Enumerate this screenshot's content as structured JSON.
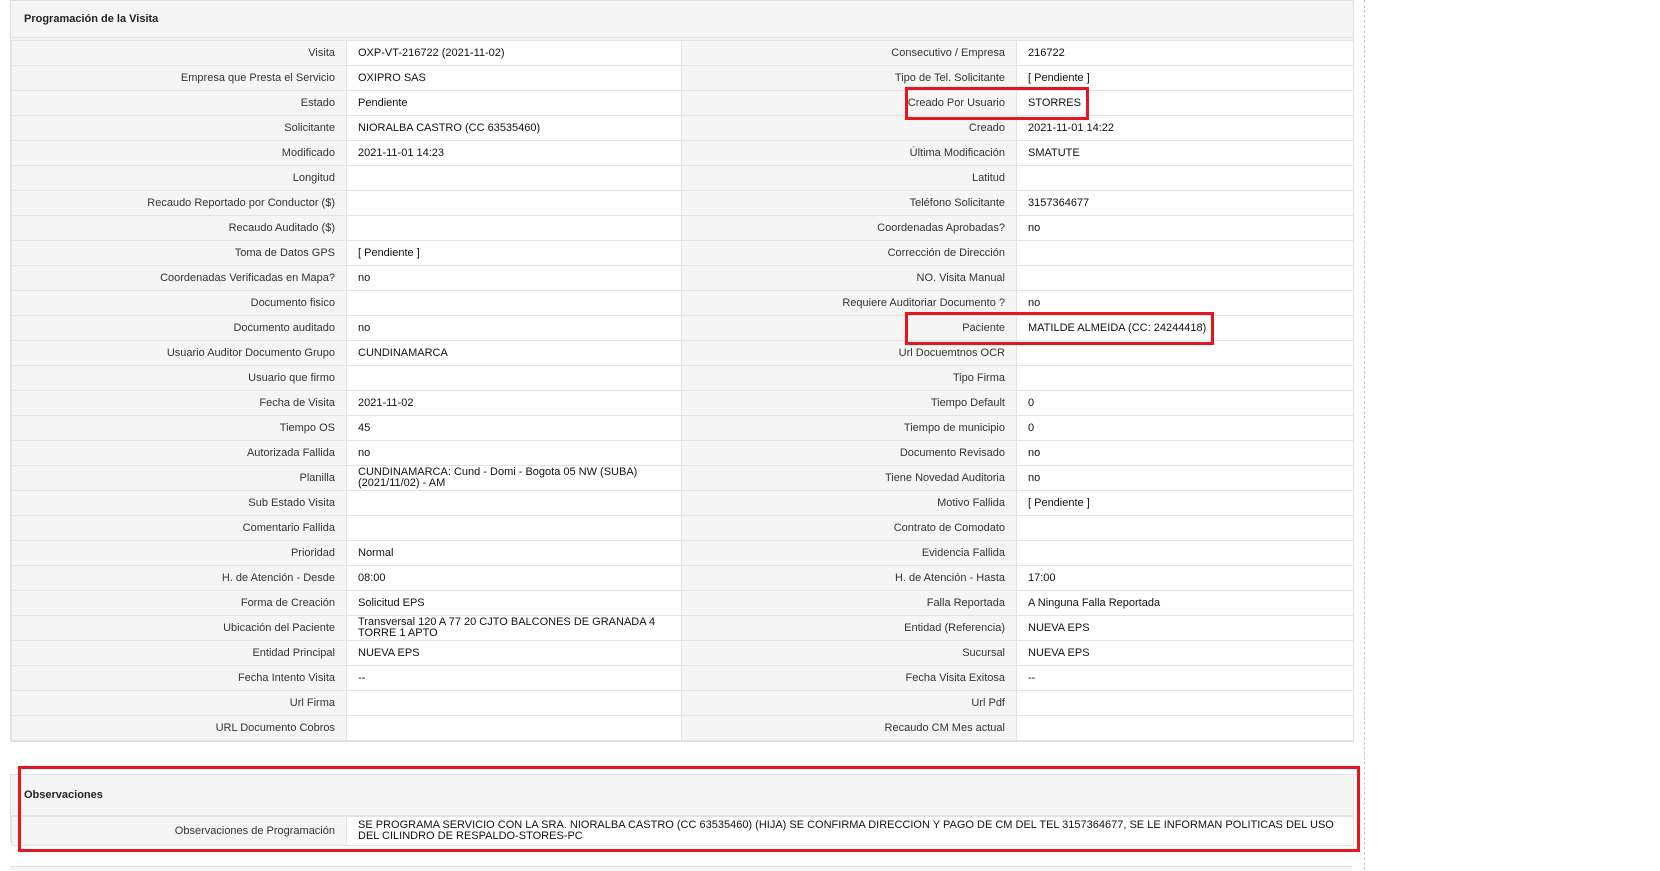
{
  "visit_section": {
    "title": "Programación de la Visita",
    "rows": [
      {
        "l1": "Visita",
        "v1": "OXP-VT-216722 (2021-11-02)",
        "l2": "Consecutivo / Empresa",
        "v2": "216722"
      },
      {
        "l1": "Empresa que Presta el Servicio",
        "v1": "OXIPRO SAS",
        "l2": "Tipo de Tel. Solicitante",
        "v2": "[ Pendiente ]"
      },
      {
        "l1": "Estado",
        "v1": "Pendiente",
        "l2": "Creado Por Usuario",
        "v2": "STORRES"
      },
      {
        "l1": "Solicitante",
        "v1": "NIORALBA CASTRO (CC 63535460)",
        "l2": "Creado",
        "v2": "2021-11-01 14:22"
      },
      {
        "l1": "Modificado",
        "v1": "2021-11-01 14:23",
        "l2": "Última Modificación",
        "v2": " SMATUTE"
      },
      {
        "l1": "Longitud",
        "v1": "",
        "l2": "Latitud",
        "v2": ""
      },
      {
        "l1": "Recaudo Reportado por Conductor ($)",
        "v1": "",
        "l2": "Teléfono Solicitante",
        "v2": "3157364677"
      },
      {
        "l1": "Recaudo Auditado ($)",
        "v1": "",
        "l2": "Coordenadas Aprobadas?",
        "v2": " no"
      },
      {
        "l1": "Toma de Datos GPS",
        "v1": "[ Pendiente ]",
        "l2": "Corrección de Dirección",
        "v2": ""
      },
      {
        "l1": "Coordenadas Verificadas en Mapa?",
        "v1": " no",
        "l2": "NO. Visita Manual",
        "v2": ""
      },
      {
        "l1": "Documento fisico",
        "v1": "",
        "l2": "Requiere Auditoriar Documento ?",
        "v2": " no"
      },
      {
        "l1": "Documento auditado",
        "v1": " no",
        "l2": "Paciente",
        "v2": "MATILDE ALMEIDA (CC: 24244418)"
      },
      {
        "l1": "Usuario Auditor Documento Grupo",
        "v1": "CUNDINAMARCA",
        "l2": "Url Docuemtnos OCR",
        "v2": ""
      },
      {
        "l1": "Usuario que firmo",
        "v1": "",
        "l2": "Tipo Firma",
        "v2": ""
      },
      {
        "l1": "Fecha de Visita",
        "v1": " 2021-11-02",
        "l2": "Tiempo Default",
        "v2": "0"
      },
      {
        "l1": "Tiempo OS",
        "v1": "45",
        "l2": "Tiempo de municipio",
        "v2": "0"
      },
      {
        "l1": "Autorizada Fallida",
        "v1": " no",
        "l2": "Documento Revisado",
        "v2": " no"
      },
      {
        "l1": "Planilla",
        "v1": "CUNDINAMARCA: Cund - Domi - Bogota 05 NW (SUBA) (2021/11/02) - AM",
        "l2": "Tiene Novedad Auditoria",
        "v2": " no"
      },
      {
        "l1": "Sub Estado Visita",
        "v1": "",
        "l2": "Motivo Fallida",
        "v2": "[ Pendiente ]"
      },
      {
        "l1": "Comentario Fallida",
        "v1": "",
        "l2": "Contrato de Comodato",
        "v2": ""
      },
      {
        "l1": "Prioridad",
        "v1": "Normal",
        "l2": "Evidencia Fallida",
        "v2": ""
      },
      {
        "l1": "H. de Atención - Desde",
        "v1": "08:00",
        "l2": "H. de Atención - Hasta",
        "v2": "17:00"
      },
      {
        "l1": "Forma de Creación",
        "v1": "Solicitud EPS",
        "l2": "Falla Reportada",
        "v2": "A Ninguna Falla Reportada"
      },
      {
        "l1": "Ubicación del Paciente",
        "v1": "Transversal 120 A 77 20 CJTO BALCONES DE GRANADA 4 TORRE 1 APTO",
        "l2": "Entidad (Referencia)",
        "v2": "NUEVA EPS"
      },
      {
        "l1": "Entidad Principal",
        "v1": "NUEVA EPS",
        "l2": "Sucursal",
        "v2": "NUEVA EPS"
      },
      {
        "l1": "Fecha Intento Visita",
        "v1": " --",
        "l2": "Fecha Visita Exitosa",
        "v2": " --"
      },
      {
        "l1": "Url Firma",
        "v1": "",
        "l2": "Url Pdf",
        "v2": ""
      },
      {
        "l1": "URL Documento Cobros",
        "v1": "",
        "l2": "Recaudo CM Mes actual",
        "v2": ""
      }
    ]
  },
  "observations": {
    "title": "Observaciones",
    "label": "Observaciones de Programación",
    "text": " SE PROGRAMA SERVICIO CON LA SRA. NIORALBA CASTRO (CC 63535460) (HIJA) SE CONFIRMA DIRECCION Y PAGO DE CM DEL TEL 3157364677, SE LE INFORMAN POLITICAS DEL USO DEL CILINDRO DE RESPALDO-STORES-PC"
  },
  "highlight_color": "#e8151e"
}
